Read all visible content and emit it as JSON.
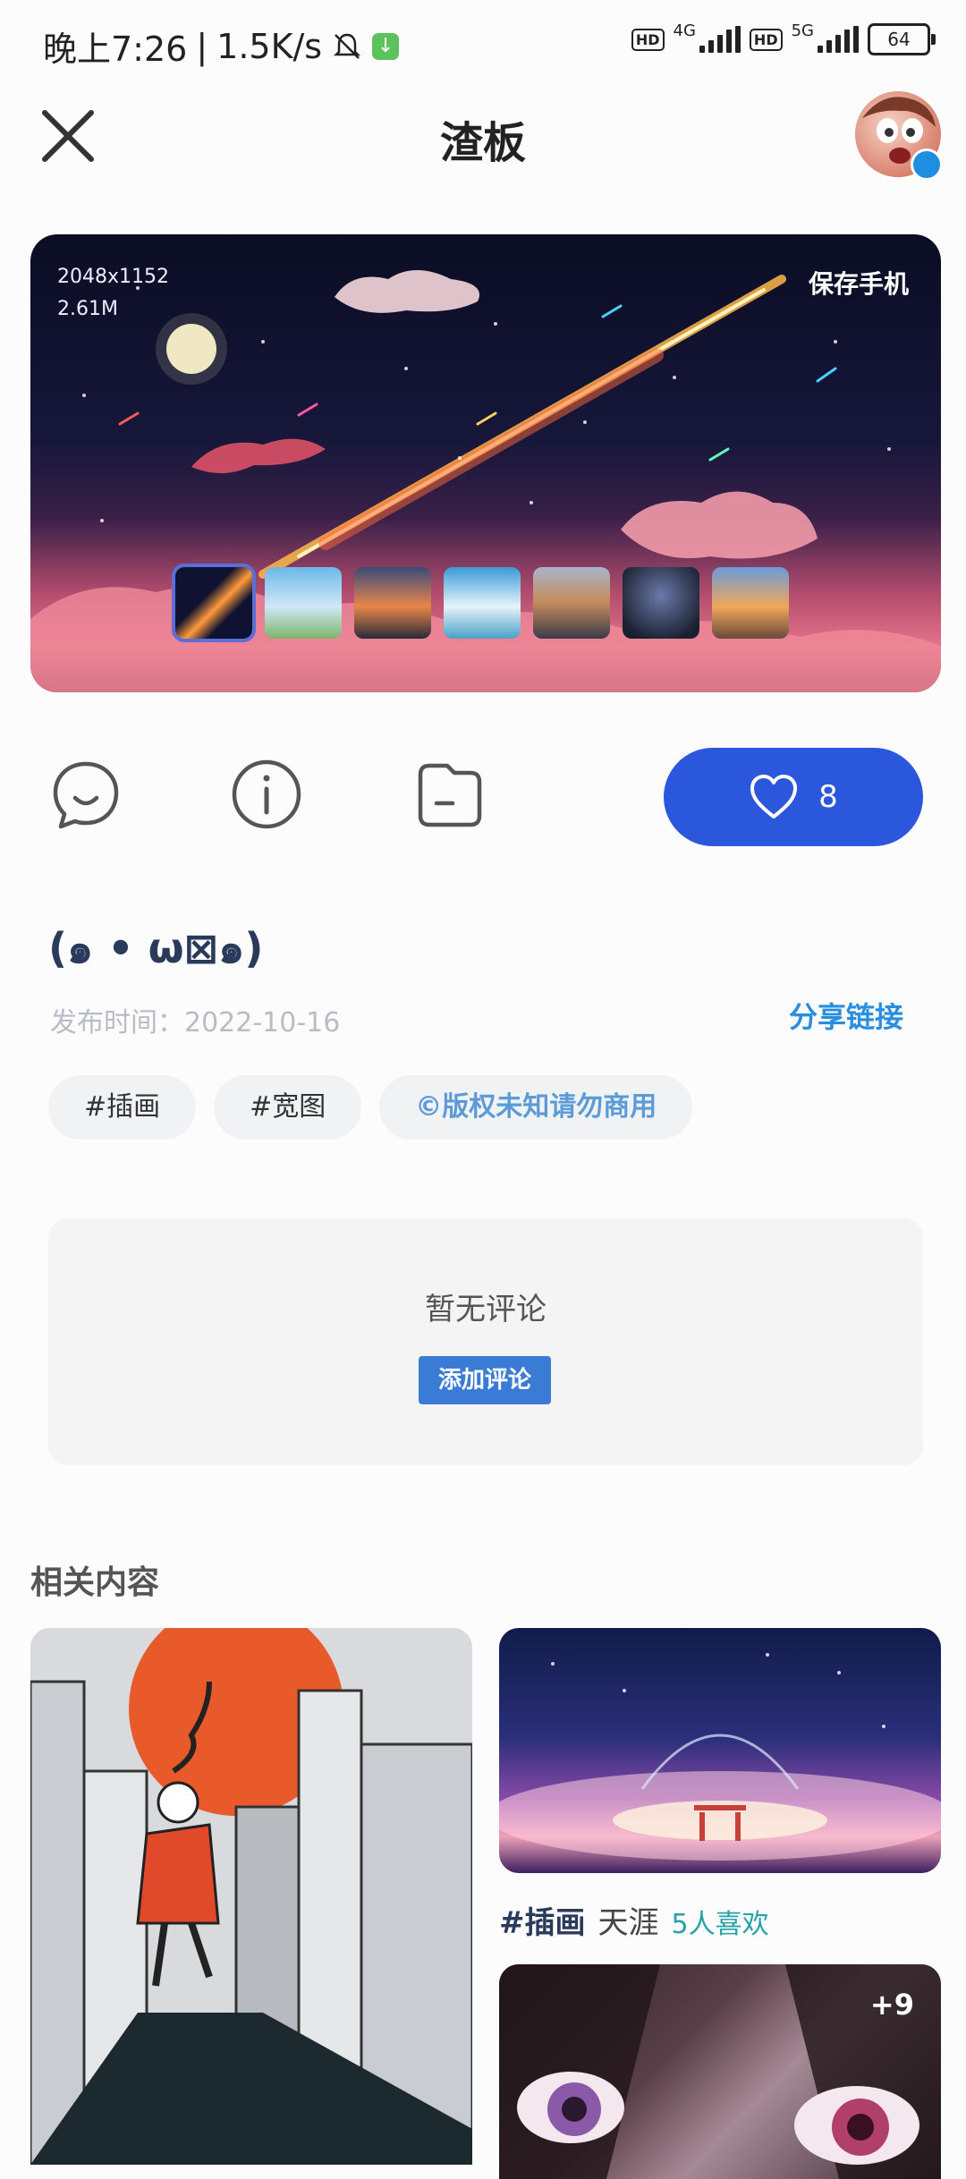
{
  "status_bar": {
    "time": "晚上7:26",
    "speed": "1.5K/s",
    "network_1": "4G",
    "network_2": "5G",
    "hd_label": "HD",
    "battery": "64"
  },
  "header": {
    "title": "渣板",
    "close_icon": "close-icon",
    "avatar": "user-avatar"
  },
  "hero": {
    "resolution": "2048x1152",
    "size": "2.61M",
    "save_label": "保存手机",
    "thumbnails": [
      "meteor-night",
      "grass-sky",
      "sunset-clouds",
      "blue-clouds",
      "mountain-road",
      "starry-forest",
      "sunset-town"
    ],
    "active_thumbnail": 0
  },
  "actions": {
    "comment_icon": "comment-icon",
    "info_icon": "info-icon",
    "folder_icon": "folder-icon",
    "like_icon": "heart-icon",
    "like_count": "8"
  },
  "post": {
    "title": "(๑ • ω⊠๑)",
    "publish_label": "发布时间：2022-10-16",
    "share_label": "分享链接",
    "tags": [
      "#插画",
      "#宽图",
      "©版权未知请勿商用"
    ]
  },
  "comments": {
    "empty_text": "暂无评论",
    "add_label": "添加评论"
  },
  "related": {
    "title": "相关内容",
    "items": [
      {
        "tag": "#插画",
        "author": "天涯",
        "likes": "5人喜欢"
      }
    ],
    "more_badge": "+9"
  },
  "colors": {
    "accent": "#2a57dc",
    "link": "#2a8ee0",
    "copyright_tag": "#5b9bd8",
    "likes": "#2aa0a8"
  }
}
